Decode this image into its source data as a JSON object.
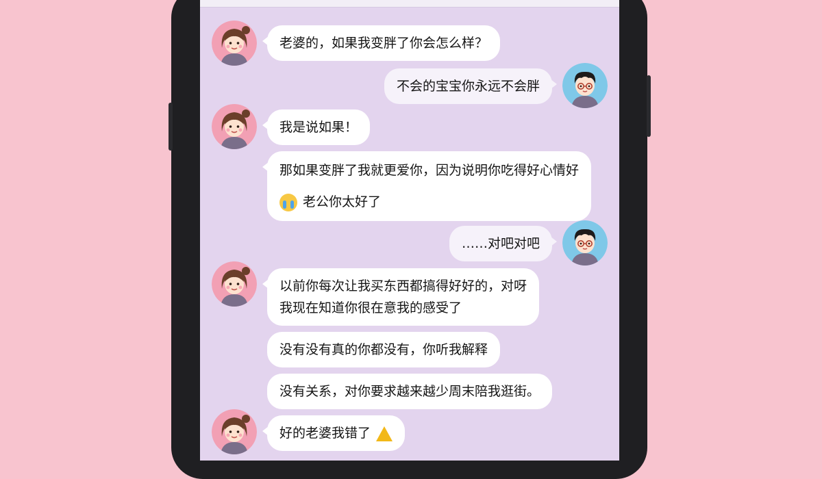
{
  "chat": {
    "messages": [
      {
        "sender": "wife",
        "lines": [
          "老婆的，如果我变胖了你会怎么样？"
        ]
      },
      {
        "sender": "husband",
        "lines": [
          "不会的宝宝你永远不会胖"
        ]
      },
      {
        "sender": "wife",
        "lines": [
          "我是说如果！"
        ]
      },
      {
        "sender": "wife",
        "lines": [
          "那如果变胖了我就更爱你，因为说明你吃得好心情好",
          "老公你太好了"
        ]
      },
      {
        "sender": "husband",
        "lines": [
          "……对吧对吧"
        ]
      },
      {
        "sender": "wife",
        "lines": [
          "以前你每次让我买东西都搞得好好的，对呀",
          "我现在知道你很在意我的感受了"
        ]
      },
      {
        "sender": "wife",
        "lines": [
          "没有没有真的你都没有，你听我解释"
        ]
      },
      {
        "sender": "wife",
        "lines": [
          "没有关系，对你要求越来越少周末陪我逛街。"
        ]
      },
      {
        "sender": "wife",
        "lines": [
          "好的老婆我错了"
        ]
      }
    ]
  },
  "icons": {
    "wife_avatar": "girl-avatar-icon",
    "husband_avatar": "boy-with-glasses-avatar-icon",
    "crying_emoji": "crying-face-emoji-icon",
    "warning_emoji": "warning-triangle-emoji-icon"
  },
  "colors": {
    "page_background": "#f8c4cf",
    "chat_background": "#e3d4ee",
    "bubble": "#ffffff",
    "phone_frame": "#1f1f22",
    "wife_avatar_bg": "#f2a0b4",
    "husband_avatar_bg": "#7fc8e8"
  }
}
